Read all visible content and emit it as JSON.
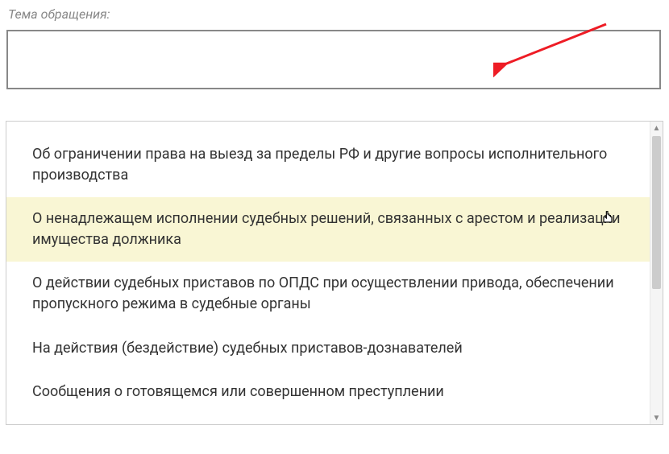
{
  "field": {
    "label": "Тема обращения:"
  },
  "dropdown": {
    "items": [
      {
        "label": "Об ограничении права на выезд за пределы РФ и другие вопросы исполнительного производства",
        "highlighted": false
      },
      {
        "label": "О ненадлежащем исполнении судебных решений, связанных с арестом и реализации имущества должника",
        "highlighted": true
      },
      {
        "label": "О действии судебных приставов по ОПДС при осуществлении привода, обеспечении пропускного режима в судебные органы",
        "highlighted": false
      },
      {
        "label": "На действия (бездействие) судебных приставов-дознавателей",
        "highlighted": false
      },
      {
        "label": "Сообщения о готовящемся или совершенном преступлении",
        "highlighted": false
      }
    ]
  }
}
